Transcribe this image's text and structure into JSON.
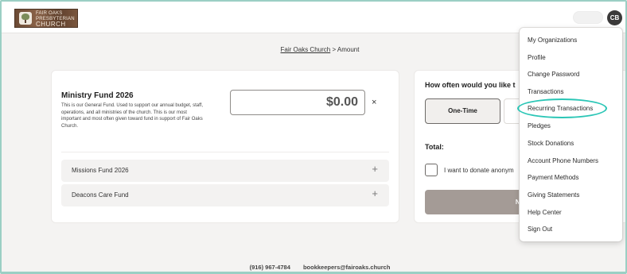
{
  "header": {
    "logo_lines": [
      "FAIR OAKS",
      "PRESBYTERIAN",
      "CHURCH"
    ],
    "avatar_initials": "CB"
  },
  "breadcrumb": {
    "link": "Fair Oaks Church",
    "separator": ">",
    "current": "Amount"
  },
  "fund": {
    "title": "Ministry Fund 2026",
    "description": "This is our General Fund. Used to support our annual budget, staff, operations, and all ministries of the church. This is our most important and most often given toward fund in support of Fair Oaks Church.",
    "amount": "$0.00",
    "remove_symbol": "×",
    "other_funds": [
      {
        "label": "Missions Fund 2026",
        "icon": "+"
      },
      {
        "label": "Deacons Care Fund",
        "icon": "+"
      }
    ]
  },
  "giving": {
    "frequency_question": "How often would you like t",
    "frequency_selected": "One-Time",
    "total_label": "Total:",
    "anonymous_label": "I want to donate anonym",
    "next_button": "Next"
  },
  "footer": {
    "phone": "(916) 967-4784",
    "email": "bookkeepers@fairoaks.church"
  },
  "user_menu": {
    "items": [
      "My Organizations",
      "Profile",
      "Change Password",
      "Transactions",
      "Recurring Transactions",
      "Pledges",
      "Stock Donations",
      "Account Phone Numbers",
      "Payment Methods",
      "Giving Statements",
      "Help Center",
      "Sign Out"
    ],
    "highlighted_item": "Recurring Transactions"
  },
  "colors": {
    "highlight": "#2bc6b6",
    "next_button": "#a49b96",
    "avatar": "#3b3a3a",
    "frame_border": "#9bcfc4"
  }
}
